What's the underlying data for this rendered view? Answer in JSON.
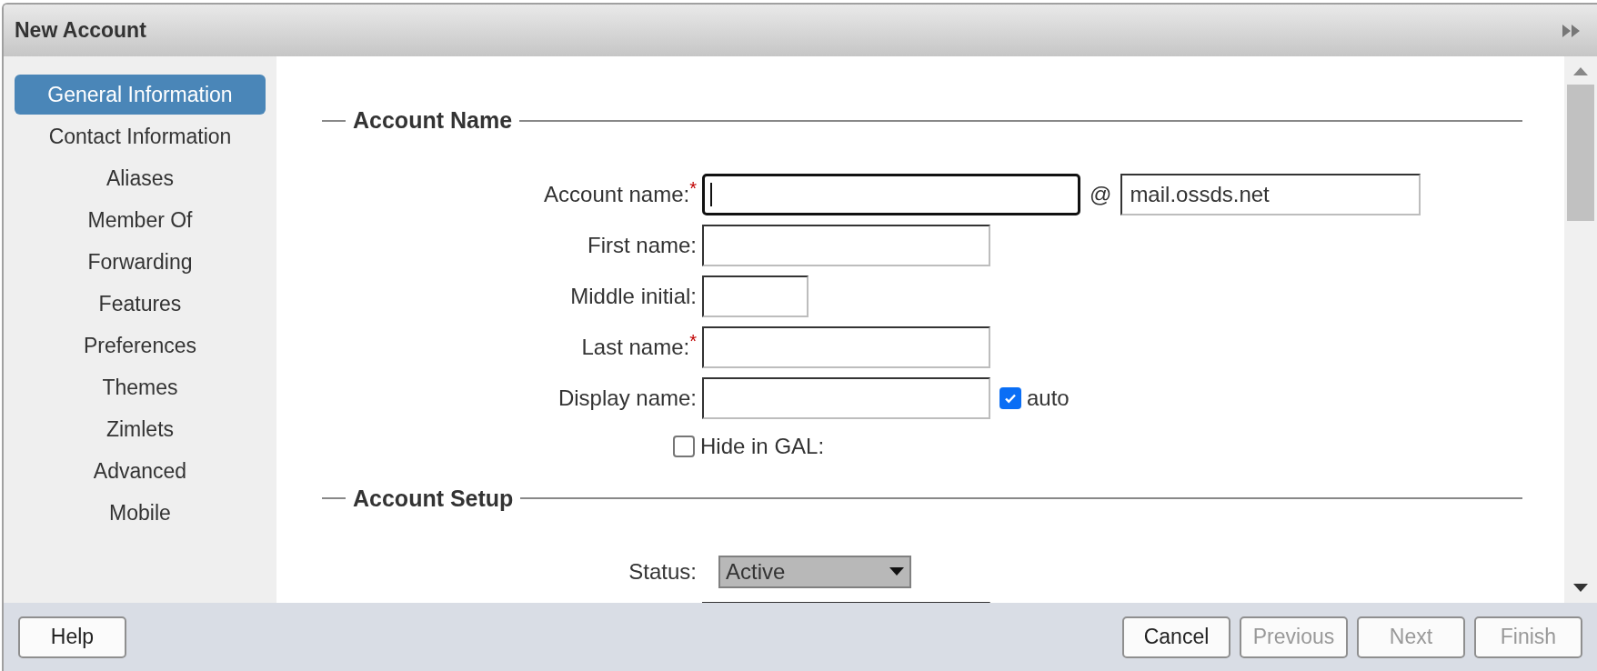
{
  "window": {
    "title": "New Account"
  },
  "sidebar": {
    "items": [
      {
        "label": "General Information",
        "selected": true
      },
      {
        "label": "Contact Information",
        "selected": false
      },
      {
        "label": "Aliases",
        "selected": false
      },
      {
        "label": "Member Of",
        "selected": false
      },
      {
        "label": "Forwarding",
        "selected": false
      },
      {
        "label": "Features",
        "selected": false
      },
      {
        "label": "Preferences",
        "selected": false
      },
      {
        "label": "Themes",
        "selected": false
      },
      {
        "label": "Zimlets",
        "selected": false
      },
      {
        "label": "Advanced",
        "selected": false
      },
      {
        "label": "Mobile",
        "selected": false
      }
    ]
  },
  "sections": [
    {
      "title": "Account Name",
      "fields": [
        {
          "kind": "long",
          "label": "Account name:",
          "required_mark": "*",
          "focused": true,
          "suffix": "@",
          "domain": "mail.ossds.net"
        },
        {
          "kind": "text",
          "label": "First name:",
          "focused": false
        },
        {
          "kind": "short",
          "label": "Middle initial:",
          "focused": false
        },
        {
          "kind": "text",
          "label": "Last name:",
          "required_mark": "*",
          "focused": false
        },
        {
          "kind": "text",
          "label": "Display name:",
          "focused": false,
          "option": {
            "label": "auto",
            "checked": true
          }
        },
        {
          "kind": "checkbox",
          "label": "Hide in GAL:",
          "checked": false
        }
      ]
    },
    {
      "title": "Account Setup",
      "fields": [
        {
          "kind": "select",
          "label": "Status:",
          "value": "Active"
        },
        {
          "kind": "text",
          "focused": false
        }
      ]
    }
  ],
  "footer": {
    "buttons": [
      {
        "label": "Help",
        "disabled": false
      },
      {
        "label": "Cancel",
        "disabled": false
      },
      {
        "label": "Previous",
        "disabled": true
      },
      {
        "label": "Next",
        "disabled": true
      },
      {
        "label": "Finish",
        "disabled": true
      }
    ]
  }
}
